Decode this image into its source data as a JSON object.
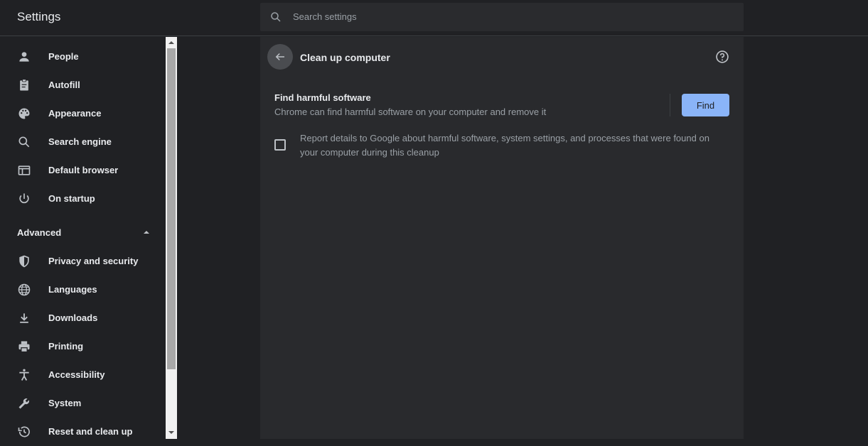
{
  "header": {
    "title": "Settings",
    "search_placeholder": "Search settings"
  },
  "sidebar": {
    "items": [
      {
        "label": "People",
        "icon": "person-icon"
      },
      {
        "label": "Autofill",
        "icon": "clipboard-icon"
      },
      {
        "label": "Appearance",
        "icon": "palette-icon"
      },
      {
        "label": "Search engine",
        "icon": "search-icon"
      },
      {
        "label": "Default browser",
        "icon": "browser-icon"
      },
      {
        "label": "On startup",
        "icon": "power-icon"
      }
    ],
    "advanced_label": "Advanced",
    "advanced_items": [
      {
        "label": "Privacy and security",
        "icon": "shield-icon"
      },
      {
        "label": "Languages",
        "icon": "globe-icon"
      },
      {
        "label": "Downloads",
        "icon": "download-icon"
      },
      {
        "label": "Printing",
        "icon": "printer-icon"
      },
      {
        "label": "Accessibility",
        "icon": "accessibility-icon"
      },
      {
        "label": "System",
        "icon": "wrench-icon"
      },
      {
        "label": "Reset and clean up",
        "icon": "history-icon"
      }
    ]
  },
  "main": {
    "title": "Clean up computer",
    "find_title": "Find harmful software",
    "find_subtitle": "Chrome can find harmful software on your computer and remove it",
    "find_button": "Find",
    "report_checkbox_label": "Report details to Google about harmful software, system settings, and processes that were found on your computer during this cleanup",
    "report_checked": false
  },
  "colors": {
    "background": "#202124",
    "panel": "#292a2d",
    "accent": "#8ab4f8",
    "text": "#e8eaed",
    "secondary_text": "#9aa0a6"
  }
}
